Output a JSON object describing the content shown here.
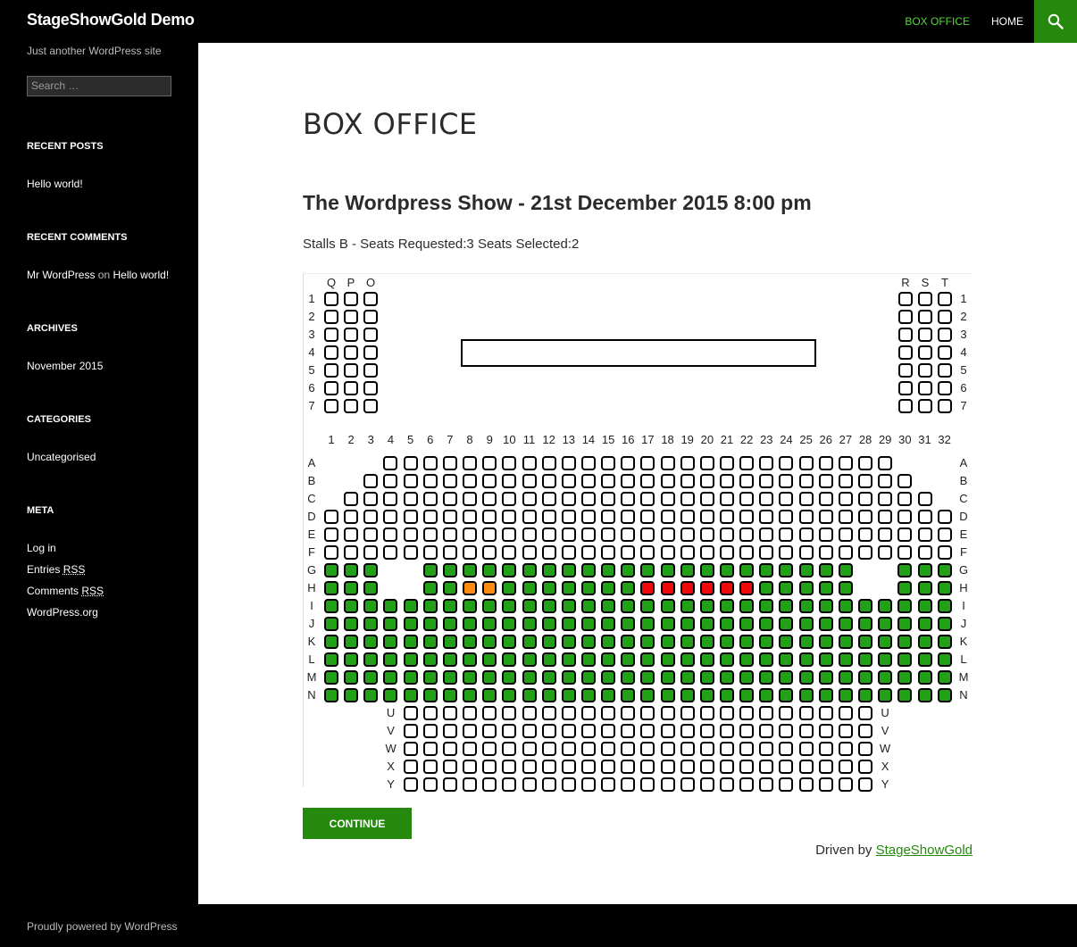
{
  "site": {
    "title": "StageShowGold Demo",
    "tagline": "Just another WordPress site"
  },
  "nav": {
    "items": [
      {
        "label": "BOX OFFICE",
        "current": true
      },
      {
        "label": "HOME",
        "current": false
      }
    ],
    "search_icon": "search-icon"
  },
  "sidebar": {
    "search_placeholder": "Search …",
    "recent_posts": {
      "title": "RECENT POSTS",
      "items": [
        "Hello world!"
      ]
    },
    "recent_comments": {
      "title": "RECENT COMMENTS",
      "author": "Mr WordPress",
      "on": "on",
      "post": "Hello world!"
    },
    "archives": {
      "title": "ARCHIVES",
      "items": [
        "November 2015"
      ]
    },
    "categories": {
      "title": "CATEGORIES",
      "items": [
        "Uncategorised"
      ]
    },
    "meta": {
      "title": "META",
      "login": "Log in",
      "entries": "Entries",
      "comments": "Comments",
      "rss": "RSS",
      "wordpress_org": "WordPress.org"
    }
  },
  "main": {
    "page_title": "BOX OFFICE",
    "show_title": "The Wordpress Show - 21st December 2015 8:00 pm",
    "stalls_info": "Stalls B - Seats Requested:3 Seats Selected:2",
    "continue_label": "CONTINUE",
    "driven_by": "Driven by",
    "driven_link": "StageShowGold"
  },
  "seatmap": {
    "left_wing_cols": [
      "Q",
      "P",
      "O"
    ],
    "right_wing_cols": [
      "R",
      "S",
      "T"
    ],
    "wing_rows": [
      "1",
      "2",
      "3",
      "4",
      "5",
      "6",
      "7"
    ],
    "col_numbers": [
      "1",
      "2",
      "3",
      "4",
      "5",
      "6",
      "7",
      "8",
      "9",
      "10",
      "11",
      "12",
      "13",
      "14",
      "15",
      "16",
      "17",
      "18",
      "19",
      "20",
      "21",
      "22",
      "23",
      "24",
      "25",
      "26",
      "27",
      "28",
      "29",
      "30",
      "31",
      "32"
    ],
    "rows": [
      {
        "label": "A",
        "from": 4,
        "to": 29,
        "status": "empty"
      },
      {
        "label": "B",
        "from": 3,
        "to": 30,
        "status": "empty"
      },
      {
        "label": "C",
        "from": 2,
        "to": 31,
        "status": "empty"
      },
      {
        "label": "D",
        "from": 1,
        "to": 32,
        "status": "empty"
      },
      {
        "label": "E",
        "from": 1,
        "to": 32,
        "status": "empty"
      },
      {
        "label": "F",
        "from": 1,
        "to": 32,
        "status": "empty"
      },
      {
        "label": "G",
        "from": 1,
        "to": 32,
        "status": "available",
        "gaps": [
          4,
          5,
          28,
          29
        ]
      },
      {
        "label": "H",
        "from": 1,
        "to": 32,
        "status": "available",
        "gaps": [
          4,
          5,
          28,
          29
        ],
        "selected": [
          8,
          9
        ],
        "booked": [
          17,
          18,
          19,
          20,
          21,
          22
        ]
      },
      {
        "label": "I",
        "from": 1,
        "to": 32,
        "status": "available"
      },
      {
        "label": "J",
        "from": 1,
        "to": 32,
        "status": "available"
      },
      {
        "label": "K",
        "from": 1,
        "to": 32,
        "status": "available"
      },
      {
        "label": "L",
        "from": 1,
        "to": 32,
        "status": "available"
      },
      {
        "label": "M",
        "from": 1,
        "to": 32,
        "status": "available"
      },
      {
        "label": "N",
        "from": 1,
        "to": 32,
        "status": "available"
      }
    ],
    "back_rows": [
      {
        "label": "U",
        "from": 5,
        "to": 28,
        "status": "empty"
      },
      {
        "label": "V",
        "from": 5,
        "to": 28,
        "status": "empty"
      },
      {
        "label": "W",
        "from": 5,
        "to": 28,
        "status": "empty"
      },
      {
        "label": "X",
        "from": 5,
        "to": 28,
        "status": "empty"
      },
      {
        "label": "Y",
        "from": 5,
        "to": 28,
        "status": "empty"
      }
    ],
    "colors": {
      "available": "#22a017",
      "selected": "#ff8c10",
      "booked": "#ee0a0a",
      "empty": "#ffffff"
    }
  },
  "footer": {
    "text": "Proudly powered by WordPress"
  }
}
